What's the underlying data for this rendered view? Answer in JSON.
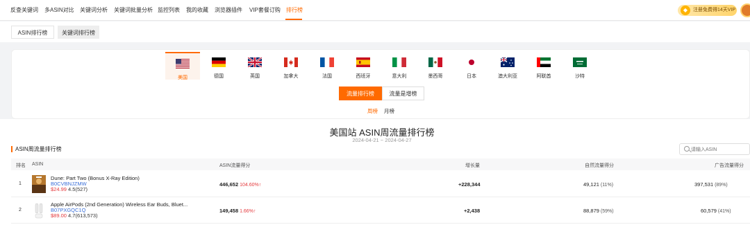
{
  "topnav": {
    "items": [
      "反查关键词",
      "多ASIN对比",
      "关键词分析",
      "关键词批量分析",
      "监控列表",
      "我的收藏",
      "浏览器插件",
      "VIP套餐订购",
      "排行榜"
    ],
    "active_index": 8,
    "vip_label": "注册免费得14天VIP"
  },
  "tabs": [
    "ASIN排行榜",
    "关键词排行榜"
  ],
  "countries": [
    "美国",
    "德国",
    "英国",
    "加拿大",
    "法国",
    "西班牙",
    "意大利",
    "墨西哥",
    "日本",
    "澳大利亚",
    "阿联酋",
    "沙特"
  ],
  "active_country": 0,
  "rank_types": [
    "流量排行榜",
    "流量是增榜"
  ],
  "periods": [
    "周榜",
    "月榜"
  ],
  "page_title": "美国站  ASIN周流量排行榜",
  "date_range": "2024-04-21 ~ 2024-04-27",
  "section_title": "ASIN周流量排行榜",
  "search": {
    "placeholder": "请输入ASIN"
  },
  "table": {
    "headers": [
      "排名",
      "ASIN",
      "ASIN流量得分",
      "增长量",
      "自然流量得分",
      "广告流量得分"
    ],
    "rows": [
      {
        "rank": "1",
        "title": "Dune: Part Two (Bonus X-Ray Edition)",
        "asin": "B0CVBNJZMW",
        "price": "$24.99",
        "rating": "4.5(527)",
        "score": "446,652",
        "score_pct": "104.60%",
        "growth": "+228,344",
        "natural": "49,121",
        "natural_pct": "(11%)",
        "ads": "397,531",
        "ads_pct": "(89%)"
      },
      {
        "rank": "2",
        "title": "Apple AirPods (2nd Generation) Wireless Ear Buds, Bluet...",
        "asin": "B07PXGQC1Q",
        "price": "$89.00",
        "rating": "4.7(613,573)",
        "score": "149,458",
        "score_pct": "1.66%",
        "growth": "+2,438",
        "natural": "88,879",
        "natural_pct": "(59%)",
        "ads": "60,579",
        "ads_pct": "(41%)"
      }
    ]
  }
}
